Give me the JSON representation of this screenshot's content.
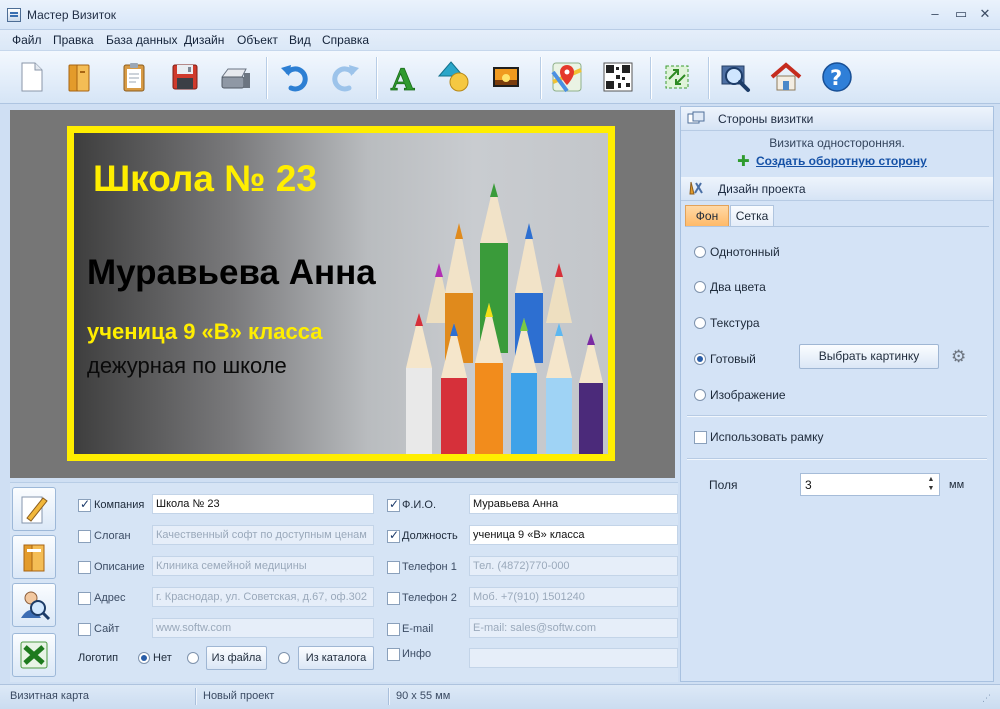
{
  "window": {
    "title": "Мастер Визиток"
  },
  "menu": [
    "Файл",
    "Правка",
    "База данных",
    "Дизайн",
    "Объект",
    "Вид",
    "Справка"
  ],
  "toolbar": {
    "icons": [
      "new-document-icon",
      "open-folder-icon",
      "clipboard-icon",
      "save-icon",
      "print-icon",
      "undo-icon",
      "redo-icon",
      "text-icon",
      "shapes-icon",
      "image-icon",
      "map-pin-icon",
      "qr-code-icon",
      "crop-icon",
      "preview-zoom-icon",
      "home-icon",
      "help-icon"
    ]
  },
  "card": {
    "company": "Школа № 23",
    "name": "Муравьева Анна",
    "position": "ученица 9 «В» класса",
    "duty": "дежурная по школе",
    "colors": {
      "border": "#ffee00",
      "company": "#ffee00",
      "position": "#ffee00",
      "name": "#000000"
    }
  },
  "fields_left": [
    {
      "label": "Компания",
      "checked": true,
      "value": "Школа № 23"
    },
    {
      "label": "Слоган",
      "checked": false,
      "value": "Качественный софт по доступным ценам"
    },
    {
      "label": "Описание",
      "checked": false,
      "value": "Клиника семейной медицины"
    },
    {
      "label": "Адрес",
      "checked": false,
      "value": "г. Краснодар, ул. Советская, д.67, оф.302"
    },
    {
      "label": "Сайт",
      "checked": false,
      "value": "www.softw.com"
    }
  ],
  "fields_right": [
    {
      "label": "Ф.И.О.",
      "checked": true,
      "value": "Муравьева Анна"
    },
    {
      "label": "Должность",
      "checked": true,
      "value": "ученица 9 «В» класса"
    },
    {
      "label": "Телефон 1",
      "checked": false,
      "value": "Тел. (4872)770-000"
    },
    {
      "label": "Телефон 2",
      "checked": false,
      "value": "Моб. +7(910) 1501240"
    },
    {
      "label": "E-mail",
      "checked": false,
      "value": "E-mail: sales@softw.com"
    },
    {
      "label": "Инфо",
      "checked": false,
      "value": ""
    }
  ],
  "logo": {
    "label": "Логотип",
    "option_none": "Нет",
    "from_file": "Из файла",
    "from_catalog": "Из каталога",
    "selected": "none"
  },
  "sides": {
    "header": "Стороны визитки",
    "info": "Визитка односторонняя.",
    "create_link": "Создать оборотную сторону"
  },
  "design": {
    "header": "Дизайн проекта",
    "tabs": [
      "Фон",
      "Сетка"
    ],
    "active_tab": "Фон",
    "options": [
      "Однотонный",
      "Два цвета",
      "Текстура",
      "Готовый",
      "Изображение"
    ],
    "selected_option": "Готовый",
    "pick_image": "Выбрать картинку",
    "use_frame": "Использовать рамку",
    "use_frame_checked": false,
    "margins_label": "Поля",
    "margins_value": "3",
    "margins_unit": "мм"
  },
  "status": {
    "mode": "Визитная карта",
    "project": "Новый проект",
    "size": "90 x 55 мм"
  }
}
